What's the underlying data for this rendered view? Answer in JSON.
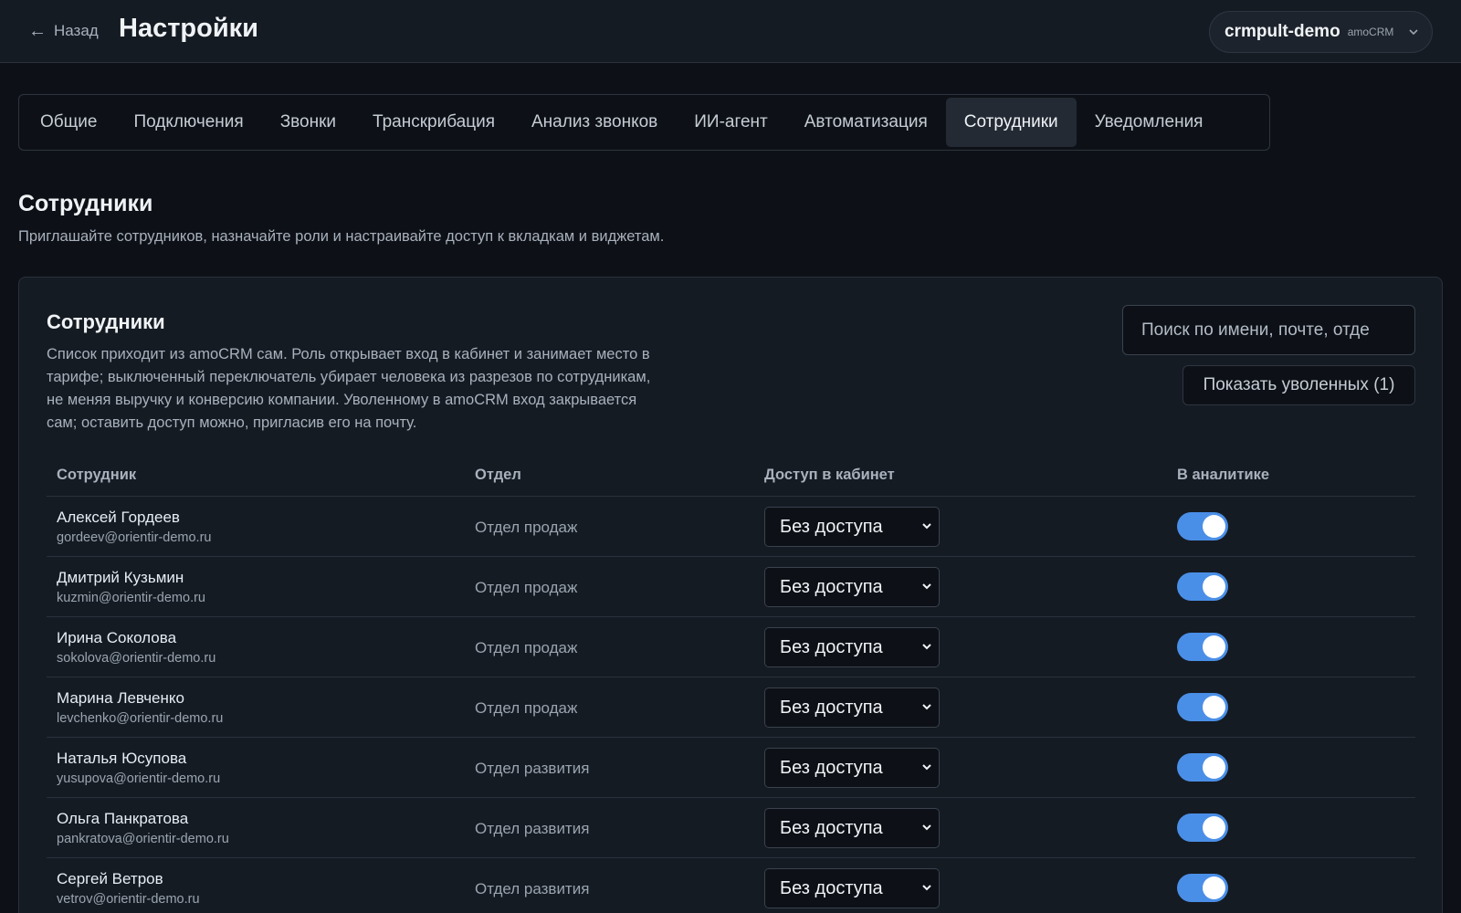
{
  "header": {
    "back_label": "Назад",
    "title": "Настройки",
    "account_name": "crmpult-demo",
    "account_platform": "amoCRM"
  },
  "tabs": [
    {
      "label": "Общие",
      "active": false
    },
    {
      "label": "Подключения",
      "active": false
    },
    {
      "label": "Звонки",
      "active": false
    },
    {
      "label": "Транскрибация",
      "active": false
    },
    {
      "label": "Анализ звонков",
      "active": false
    },
    {
      "label": "ИИ-агент",
      "active": false
    },
    {
      "label": "Автоматизация",
      "active": false
    },
    {
      "label": "Сотрудники",
      "active": true
    },
    {
      "label": "Уведомления",
      "active": false
    }
  ],
  "section": {
    "title": "Сотрудники",
    "subtitle": "Приглашайте сотрудников, назначайте роли и настраивайте доступ к вкладкам и виджетам."
  },
  "card": {
    "title": "Сотрудники",
    "description_lines": [
      "Список приходит из amoCRM сам. Роль открывает вход в кабинет и занимает место в",
      "тарифе; выключенный переключатель убирает человека из разрезов по сотрудникам,",
      "не меняя выручку и конверсию компании. Уволенному в amoCRM вход закрывается",
      "сам; оставить доступ можно, пригласив его на почту."
    ],
    "search_placeholder": "Поиск по имени, почте, отде",
    "show_fired_label": "Показать уволенных (1)"
  },
  "table": {
    "columns": {
      "employee": "Сотрудник",
      "department": "Отдел",
      "access": "Доступ в кабинет",
      "analytics": "В аналитике"
    },
    "rows": [
      {
        "name": "Алексей Гордеев",
        "email": "gordeev@orientir-demo.ru",
        "department": "Отдел продаж",
        "access": "Без доступа",
        "in_analytics": true
      },
      {
        "name": "Дмитрий Кузьмин",
        "email": "kuzmin@orientir-demo.ru",
        "department": "Отдел продаж",
        "access": "Без доступа",
        "in_analytics": true
      },
      {
        "name": "Ирина Соколова",
        "email": "sokolova@orientir-demo.ru",
        "department": "Отдел продаж",
        "access": "Без доступа",
        "in_analytics": true
      },
      {
        "name": "Марина Левченко",
        "email": "levchenko@orientir-demo.ru",
        "department": "Отдел продаж",
        "access": "Без доступа",
        "in_analytics": true
      },
      {
        "name": "Наталья Юсупова",
        "email": "yusupova@orientir-demo.ru",
        "department": "Отдел развития",
        "access": "Без доступа",
        "in_analytics": true
      },
      {
        "name": "Ольга Панкратова",
        "email": "pankratova@orientir-demo.ru",
        "department": "Отдел развития",
        "access": "Без доступа",
        "in_analytics": true
      },
      {
        "name": "Сергей Ветров",
        "email": "vetrov@orientir-demo.ru",
        "department": "Отдел развития",
        "access": "Без доступа",
        "in_analytics": true
      }
    ]
  },
  "colors": {
    "background": "#0d1117",
    "card": "#151b23",
    "toggle_on": "#4a8fe7"
  }
}
